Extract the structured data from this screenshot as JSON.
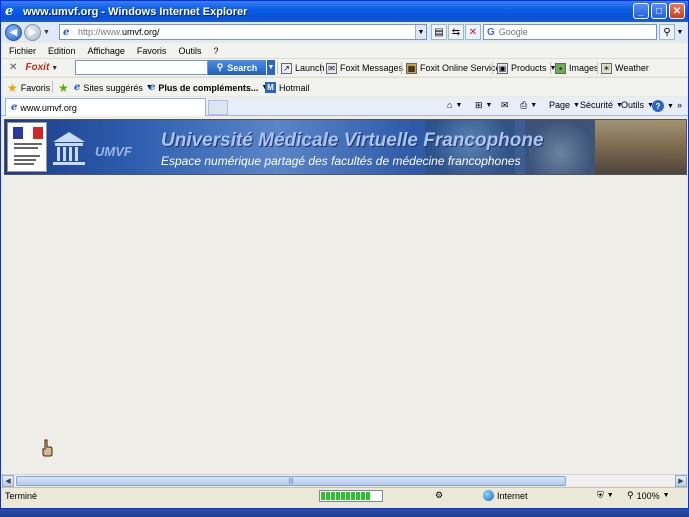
{
  "window": {
    "title": "www.umvf.org - Windows Internet Explorer",
    "controls": {
      "minimize": "_",
      "maximize": "□",
      "close": "✕"
    }
  },
  "navigation": {
    "address_prefix": "http://www.",
    "address_domain": "umvf.org/",
    "search_placeholder": "Google"
  },
  "menu": {
    "items": [
      "Fichier",
      "Edition",
      "Affichage",
      "Favoris",
      "Outils",
      "?"
    ]
  },
  "foxit_toolbar": {
    "logo": "Foxit",
    "search_label": "Search",
    "items": [
      {
        "label": "Launch",
        "icon": "launch-icon"
      },
      {
        "label": "Foxit Messages",
        "icon": "messages-icon",
        "dropdown": true
      },
      {
        "label": "Foxit Online Services",
        "icon": "online-services-icon"
      },
      {
        "label": "Products",
        "icon": "products-icon",
        "dropdown": true
      },
      {
        "label": "Images",
        "icon": "images-icon"
      },
      {
        "label": "Weather",
        "icon": "weather-icon"
      }
    ]
  },
  "favorites_bar": {
    "favorites_label": "Favoris",
    "sites_label": "Sites suggérés",
    "more_label": "Plus de compléments...",
    "hotmail_label": "Hotmail"
  },
  "tab": {
    "label": "www.umvf.org"
  },
  "command_bar": {
    "page_label": "Page",
    "security_label": "Sécurité",
    "tools_label": "Outils"
  },
  "banner": {
    "logo_text": "UMVF",
    "title": "Université Médicale Virtuelle Francophone",
    "subtitle": "Espace numérique partagé des facultés de médecine francophones"
  },
  "status": {
    "text": "Terminé",
    "zone": "Internet",
    "zoom": "100%",
    "progress_segments": 10
  },
  "colors": {
    "titlebar": "#0a5ee8",
    "banner_blue": "#3060b0",
    "progress_green": "#2cc22c",
    "content_bg": "#efede7"
  }
}
